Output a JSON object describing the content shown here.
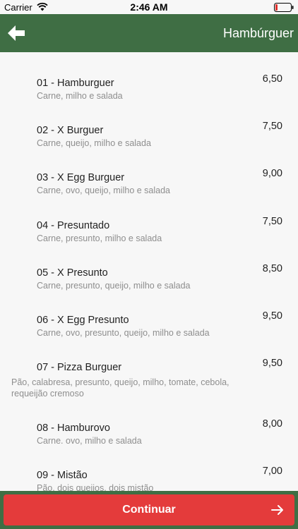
{
  "status_bar": {
    "carrier": "Carrier",
    "time": "2:46 AM"
  },
  "header": {
    "title": "Hambúrguer",
    "back_icon": "back-arrow-icon"
  },
  "items": [
    {
      "name": "01 - Hamburguer",
      "description": "Carne, milho e salada",
      "price": "6,50"
    },
    {
      "name": "02 - X Burguer",
      "description": "Carne, queijo, milho e salada",
      "price": "7,50"
    },
    {
      "name": "03 - X Egg Burguer",
      "description": "Carne, ovo, queijo, milho e salada",
      "price": "9,00"
    },
    {
      "name": "04 - Presuntado",
      "description": "Carne, presunto, milho e salada",
      "price": "7,50"
    },
    {
      "name": "05 - X Presunto",
      "description": "Carne, presunto, queijo, milho e salada",
      "price": "8,50"
    },
    {
      "name": "06 - X Egg Presunto",
      "description": "Carne, ovo, presunto, queijo, milho e salada",
      "price": "9,50"
    },
    {
      "name": "07 - Pizza Burguer",
      "description": "Pão, calabresa, presunto, queijo, milho, tomate, cebola, requeijão cremoso",
      "price": "9,50"
    },
    {
      "name": "08 - Hamburovo",
      "description": "Carne. ovo, milho e salada",
      "price": "8,00"
    },
    {
      "name": "09 - Mistão",
      "description": "Pão, dois queijos, dois mistão",
      "price": "7,00"
    }
  ],
  "footer": {
    "button_label": "Continuar",
    "button_icon": "arrow-right-icon"
  },
  "colors": {
    "header": "#3f6e44",
    "button": "#e43b3b"
  }
}
